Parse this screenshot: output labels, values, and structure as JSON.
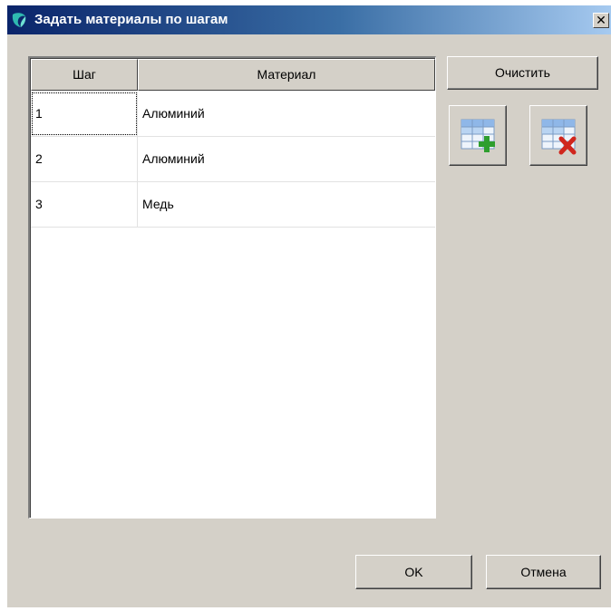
{
  "window": {
    "title": "Задать материалы по шагам",
    "close_glyph": "✕"
  },
  "table": {
    "columns": [
      "Шаг",
      "Материал"
    ],
    "rows": [
      {
        "step": "1",
        "material": "Алюминий"
      },
      {
        "step": "2",
        "material": "Алюминий"
      },
      {
        "step": "3",
        "material": "Медь"
      }
    ]
  },
  "buttons": {
    "clear": "Очистить",
    "ok": "OK",
    "cancel": "Отмена"
  },
  "icons": {
    "title": "app-logo-icon",
    "add_row": "table-add-row-icon",
    "delete_row": "table-delete-row-icon"
  },
  "colors": {
    "title_bar_start": "#0a246a",
    "title_bar_end": "#a6caf0",
    "dialog_bg": "#d4d0c8",
    "add_accent": "#2e9e2e",
    "delete_accent": "#d0261d"
  }
}
